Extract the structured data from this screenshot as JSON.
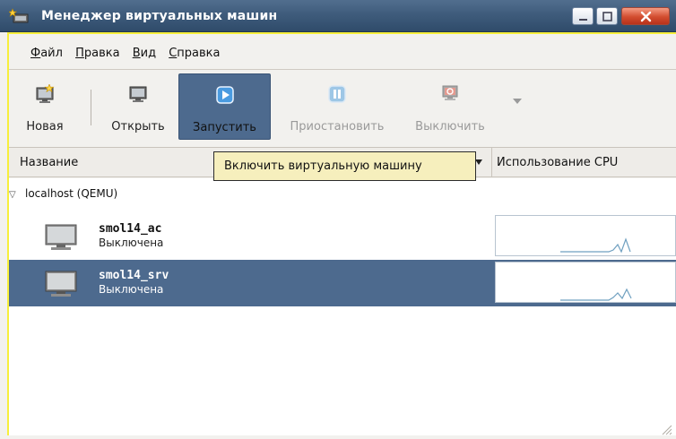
{
  "window": {
    "title": "Менеджер виртуальных машин",
    "colors": {
      "titlebar": "#3f5c7c",
      "selection": "#4d6a8e",
      "tooltip_bg": "#f6efbd",
      "frame_highlight": "#f7ef3b"
    }
  },
  "menu": {
    "file": {
      "mnemonic": "Ф",
      "rest": "айл"
    },
    "edit": {
      "mnemonic": "П",
      "rest": "равка"
    },
    "view": {
      "mnemonic": "В",
      "rest": "ид"
    },
    "help": {
      "mnemonic": "С",
      "rest": "правка"
    }
  },
  "toolbar": {
    "new": {
      "label": "Новая",
      "icon": "new-vm-icon"
    },
    "open": {
      "label": "Открыть",
      "icon": "monitor-icon"
    },
    "run": {
      "label": "Запустить",
      "icon": "play-icon",
      "state": "hovered"
    },
    "pause": {
      "label": "Приостановить",
      "icon": "pause-icon",
      "state": "disabled"
    },
    "shutdown": {
      "label": "Выключить",
      "icon": "power-icon",
      "state": "disabled"
    }
  },
  "columns": {
    "name": "Название",
    "cpu": "Использование CPU"
  },
  "tooltip": "Включить виртуальную машину",
  "group": {
    "label": "localhost (QEMU)",
    "expanded": true
  },
  "vms": [
    {
      "name": "smol14_ac",
      "status": "Выключена",
      "selected": false
    },
    {
      "name": "smol14_srv",
      "status": "Выключена",
      "selected": true
    }
  ]
}
